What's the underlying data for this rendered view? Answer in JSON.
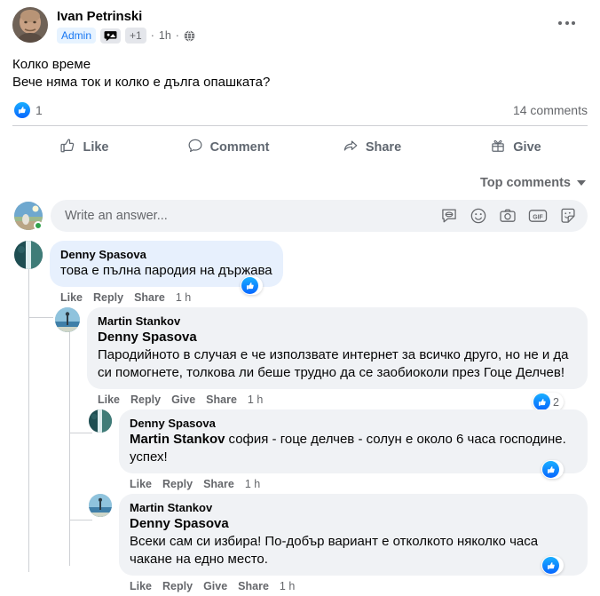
{
  "post": {
    "author": "Ivan Petrinski",
    "badges": {
      "admin": "Admin",
      "extra": "+1"
    },
    "separator1": "·",
    "time": "1h",
    "separator2": "·",
    "body_line1": "Колко време",
    "body_line2": "Вече няма ток и колко е дълга опашката?",
    "reaction_count": "1",
    "comments_count": "14 comments",
    "menu_label": "More options"
  },
  "actions": {
    "like": "Like",
    "comment": "Comment",
    "share": "Share",
    "give": "Give"
  },
  "sort": {
    "label": "Top comments"
  },
  "composer": {
    "placeholder": "Write an answer...",
    "value": ""
  },
  "comments": [
    {
      "author": "Denny Spasova",
      "mention": "",
      "text": "това е пълна пародия на държава",
      "actions": [
        "Like",
        "Reply",
        "Share"
      ],
      "time": "1 h",
      "like_count": ""
    },
    {
      "author": "Martin Stankov",
      "mention": "Denny Spasova",
      "text": "Пародийното в случая е че използвате интернет за всичко друго, но не и да си помогнете, толкова ли беше трудно да се заобиоколи през Гоце Делчев!",
      "actions": [
        "Like",
        "Reply",
        "Give",
        "Share"
      ],
      "time": "1 h",
      "like_count": "2"
    },
    {
      "author": "Denny Spasova",
      "mention": "Martin Stankov",
      "text": "софия - гоце делчев - солун е около 6 часа господине. успех!",
      "actions": [
        "Like",
        "Reply",
        "Share"
      ],
      "time": "1 h",
      "like_count": ""
    },
    {
      "author": "Martin Stankov",
      "mention": "Denny Spasova",
      "text": "Всеки сам си избира! По-добър вариант е отколкото няколко часа чакане на едно место.",
      "actions": [
        "Like",
        "Reply",
        "Give",
        "Share"
      ],
      "time": "1 h",
      "like_count": ""
    }
  ],
  "icons": {
    "comment_badge": "chat-bubble-icon",
    "globe": "globe-icon",
    "like_thumb": "thumbs-up-icon",
    "avatar_sticker": "avatar-sticker-icon",
    "emoji": "emoji-icon",
    "camera": "camera-icon",
    "gif": "GIF",
    "sticker": "sticker-icon"
  },
  "colors": {
    "accent": "#1877f2",
    "like_blue": "#0866ff",
    "bubble_gray": "#f0f2f5",
    "bubble_blue": "#e7f0fd",
    "muted": "#65676b",
    "online": "#31a24c"
  }
}
